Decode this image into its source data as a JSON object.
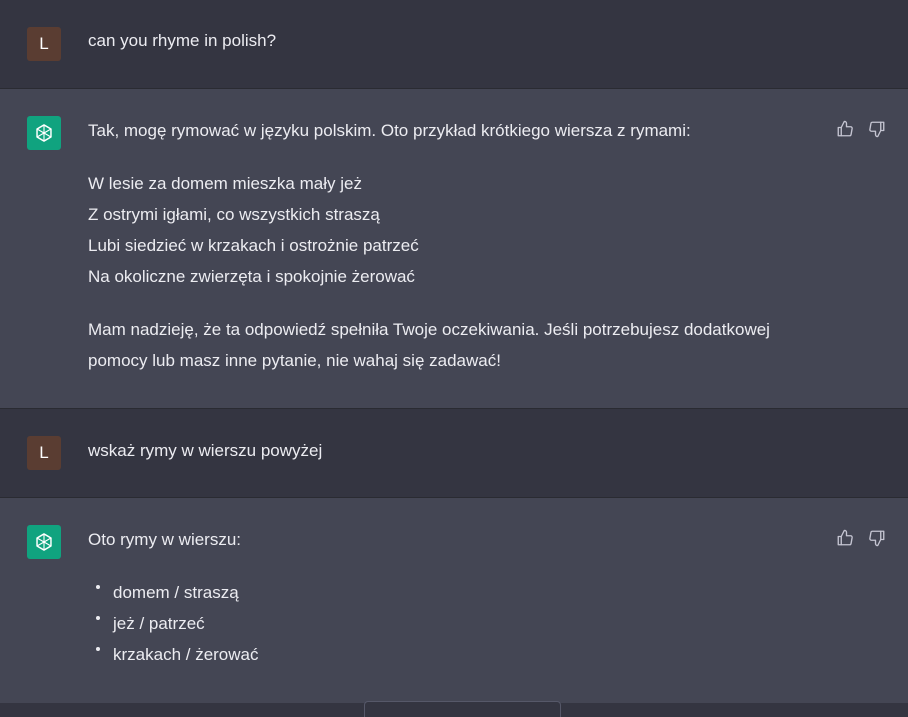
{
  "conversation": [
    {
      "role": "user",
      "avatar_letter": "L",
      "text": "can you rhyme in polish?"
    },
    {
      "role": "assistant",
      "intro": "Tak, mogę rymować w języku polskim. Oto przykład krótkiego wiersza z rymami:",
      "poem": [
        "W lesie za domem mieszka mały jeż",
        "Z ostrymi igłami, co wszystkich straszą",
        "Lubi siedzieć w krzakach i ostrożnie patrzeć",
        "Na okoliczne zwierzęta i spokojnie żerować"
      ],
      "closing": "Mam nadzieję, że ta odpowiedź spełniła Twoje oczekiwania. Jeśli potrzebujesz dodatkowej pomocy lub masz inne pytanie, nie wahaj się zadawać!"
    },
    {
      "role": "user",
      "avatar_letter": "L",
      "text": "wskaż rymy w wierszu powyżej"
    },
    {
      "role": "assistant",
      "intro": "Oto rymy w wierszu:",
      "rhymes": [
        "domem / straszą",
        "jeż / patrzeć",
        "krzakach / żerować"
      ]
    }
  ],
  "icons": {
    "bot_avatar": "openai-logo-icon",
    "like": "thumbs-up-icon",
    "dislike": "thumbs-down-icon"
  },
  "colors": {
    "background_user": "#343541",
    "background_assistant": "#444654",
    "avatar_user": "#5a3d32",
    "avatar_bot": "#10a37f",
    "text": "#ececf1"
  }
}
